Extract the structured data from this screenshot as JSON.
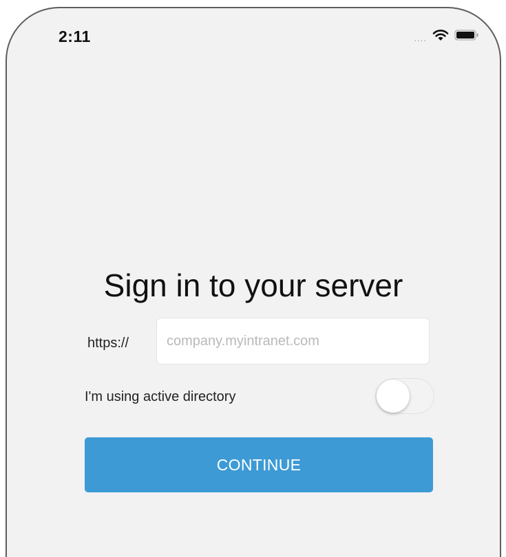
{
  "status_bar": {
    "time": "2:11",
    "signal_dots": "....",
    "wifi_icon": "wifi-icon",
    "battery_icon": "battery-icon"
  },
  "title": "Sign in to your server",
  "url_field": {
    "prefix": "https://",
    "placeholder": "company.myintranet.com",
    "value": ""
  },
  "active_directory": {
    "label": "I'm using active directory",
    "enabled": false
  },
  "continue_button": {
    "label": "CONTINUE",
    "color": "#3d9ad5"
  },
  "colors": {
    "background": "#f2f2f3",
    "text": "#111111",
    "placeholder": "#b9b9bc"
  }
}
